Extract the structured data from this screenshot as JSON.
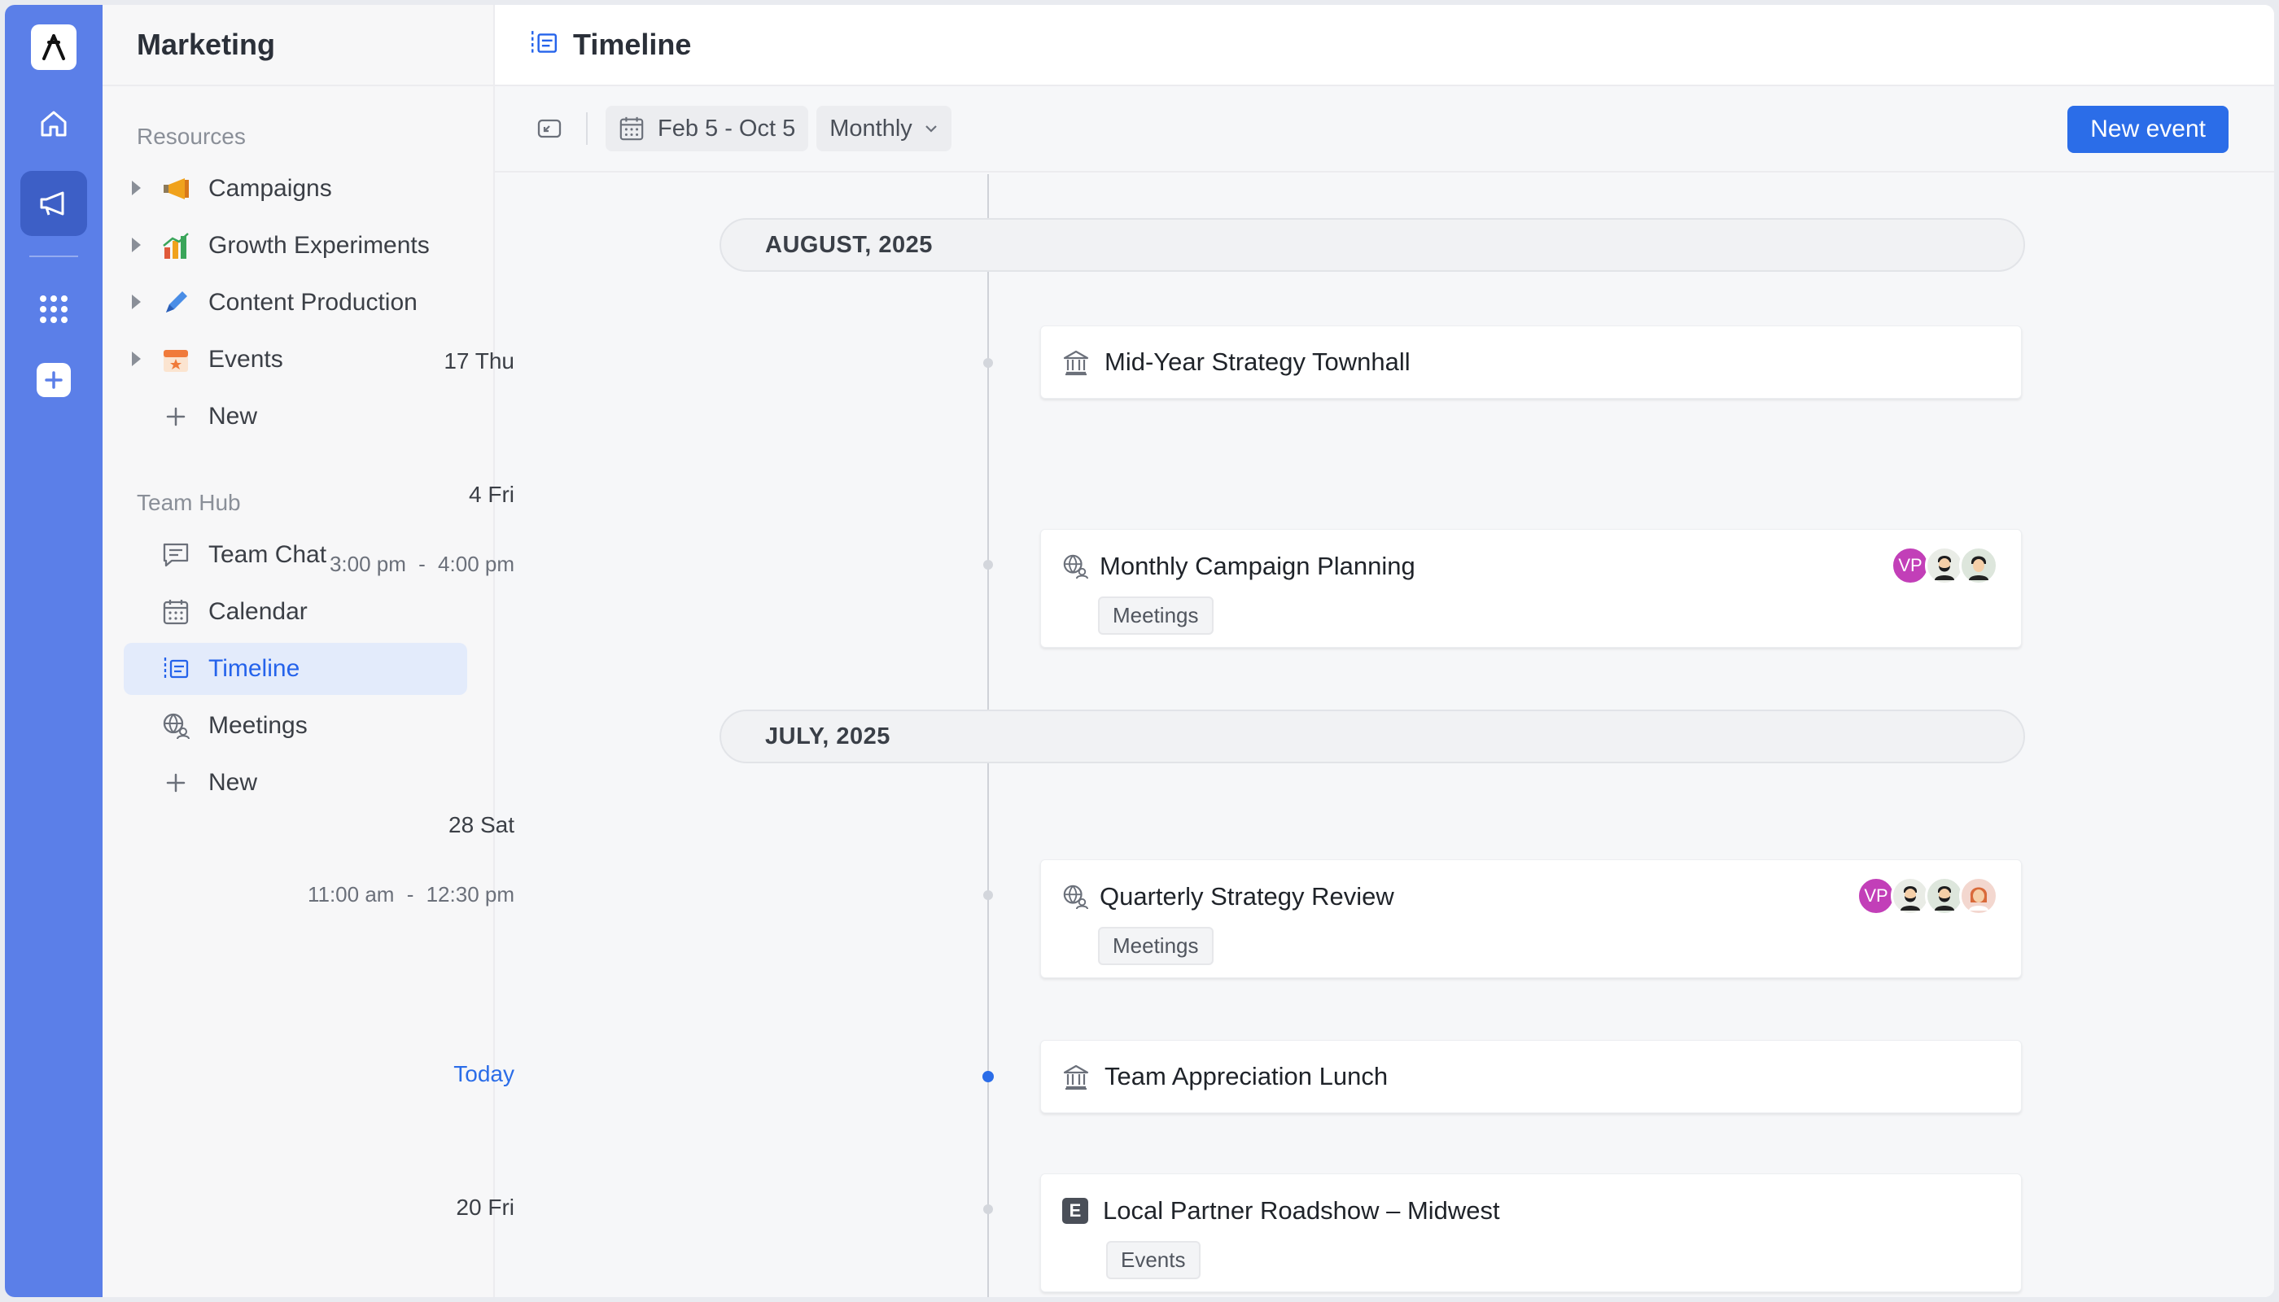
{
  "sidebar": {
    "title": "Marketing",
    "resources_label": "Resources",
    "resources": [
      {
        "label": "Campaigns",
        "icon": "megaphone-icon"
      },
      {
        "label": "Growth Experiments",
        "icon": "bar-chart-icon"
      },
      {
        "label": "Content Production",
        "icon": "pen-icon"
      },
      {
        "label": "Events",
        "icon": "calendar-star-icon"
      }
    ],
    "resources_new": "New",
    "teamhub_label": "Team Hub",
    "teamhub": [
      {
        "label": "Team Chat",
        "icon": "chat-icon"
      },
      {
        "label": "Calendar",
        "icon": "calendar-icon"
      },
      {
        "label": "Timeline",
        "icon": "timeline-icon",
        "active": true
      },
      {
        "label": "Meetings",
        "icon": "meetings-icon"
      }
    ],
    "teamhub_new": "New"
  },
  "header": {
    "title": "Timeline"
  },
  "toolbar": {
    "date_range": "Feb 5 - Oct 5",
    "view": "Monthly",
    "new_event": "New event"
  },
  "timeline": {
    "months": [
      "AUGUST, 2025",
      "JULY, 2025"
    ],
    "entries": [
      {
        "date": "17 Thu",
        "title": "Mid-Year Strategy Townhall",
        "icon": "building-icon"
      },
      {
        "date": "4 Fri",
        "time_start": "3:00 pm",
        "time_sep": "-",
        "time_end": "4:00 pm",
        "title": "Monthly Campaign Planning",
        "tag": "Meetings",
        "icon": "meetings-icon",
        "avatars": [
          "VP",
          "person",
          "person"
        ]
      },
      {
        "date": "28 Sat",
        "time_start": "11:00 am",
        "time_sep": "-",
        "time_end": "12:30 pm",
        "title": "Quarterly Strategy Review",
        "tag": "Meetings",
        "icon": "meetings-icon",
        "avatars": [
          "VP",
          "person",
          "person",
          "person"
        ]
      },
      {
        "date": "Today",
        "title": "Team Appreciation Lunch",
        "icon": "building-icon"
      },
      {
        "date": "20 Fri",
        "title": "Local Partner Roadshow – Midwest",
        "tag": "Events",
        "icon": "events-badge-icon",
        "badge_letter": "E"
      }
    ]
  },
  "colors": {
    "rail": "#5b7fe8",
    "accent": "#2b6de8",
    "vp_avatar": "#c23fb8"
  }
}
